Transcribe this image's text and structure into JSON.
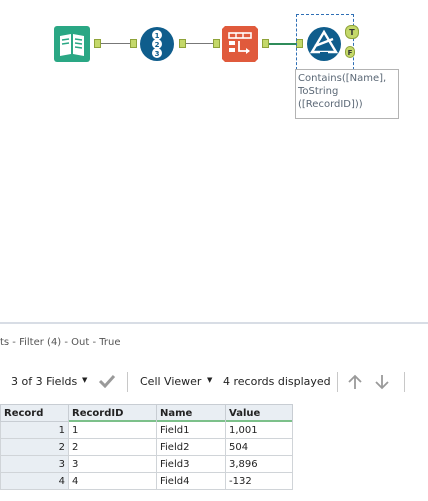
{
  "workflow": {
    "tools": [
      {
        "name": "input-data-tool",
        "icon": "book-icon",
        "color": "#2aa784"
      },
      {
        "name": "record-id-tool",
        "icon": "numbered-list-icon",
        "color": "#0f5d8c"
      },
      {
        "name": "select-tool",
        "icon": "select-fields-icon",
        "color": "#e05a3c"
      },
      {
        "name": "filter-tool",
        "icon": "filter-triangle-icon",
        "color": "#0f5d8c"
      }
    ],
    "anchor_true": "T",
    "anchor_false": "F",
    "filter_annotation": "Contains([Name],\nToString\n([RecordID]))"
  },
  "results": {
    "title": "ts - Filter (4) - Out - True",
    "fields_label": "3 of 3 Fields",
    "viewer_label": "Cell Viewer",
    "records_label": "4 records displayed",
    "columns": [
      "Record",
      "RecordID",
      "Name",
      "Value"
    ],
    "rows": [
      {
        "record": "1",
        "recordid": "1",
        "name": "Field1",
        "value": "1,001"
      },
      {
        "record": "2",
        "recordid": "2",
        "name": "Field2",
        "value": "504"
      },
      {
        "record": "3",
        "recordid": "3",
        "name": "Field3",
        "value": "3,896"
      },
      {
        "record": "4",
        "recordid": "4",
        "name": "Field4",
        "value": "-132"
      }
    ]
  },
  "colors": {
    "accent_green": "#7cc08a",
    "connector": "#c4d86a"
  }
}
